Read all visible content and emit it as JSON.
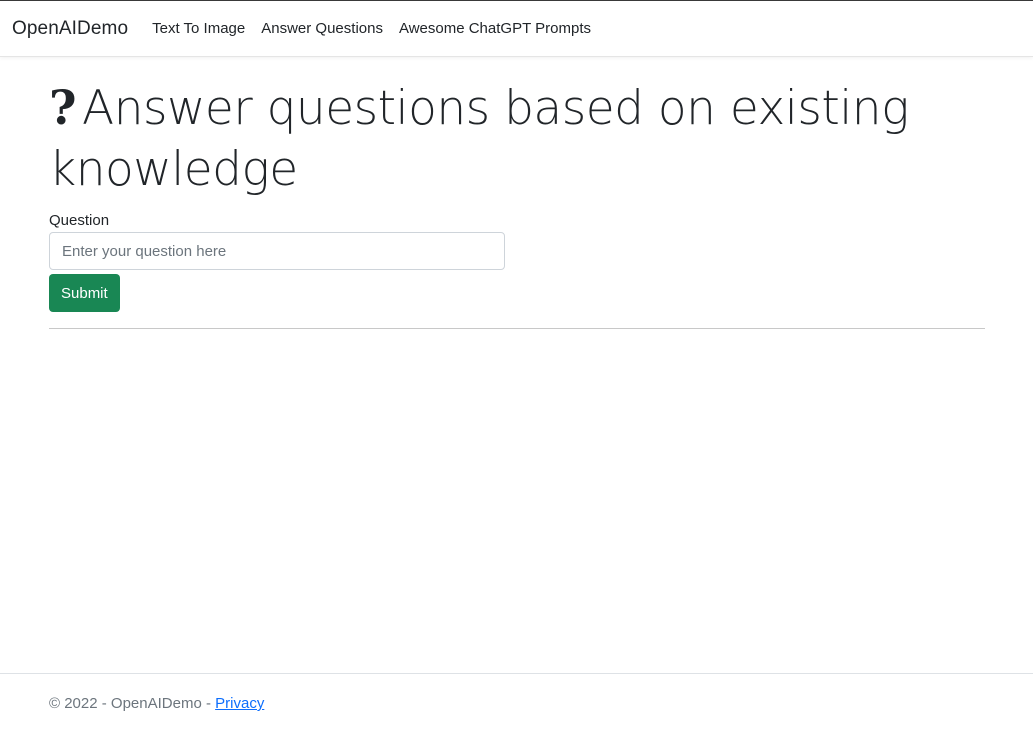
{
  "navbar": {
    "brand": "OpenAIDemo",
    "links": [
      "Text To Image",
      "Answer Questions",
      "Awesome ChatGPT Prompts"
    ]
  },
  "main": {
    "title_icon": "?",
    "title": "Answer questions based on existing knowledge",
    "form": {
      "question_label": "Question",
      "question_placeholder": "Enter your question here",
      "question_value": "",
      "submit_label": "Submit"
    }
  },
  "footer": {
    "copyright": "© 2022 - OpenAIDemo - ",
    "privacy_link": "Privacy"
  },
  "colors": {
    "primary_button": "#198754",
    "link": "#0d6efd",
    "muted_text": "#6c757d"
  }
}
